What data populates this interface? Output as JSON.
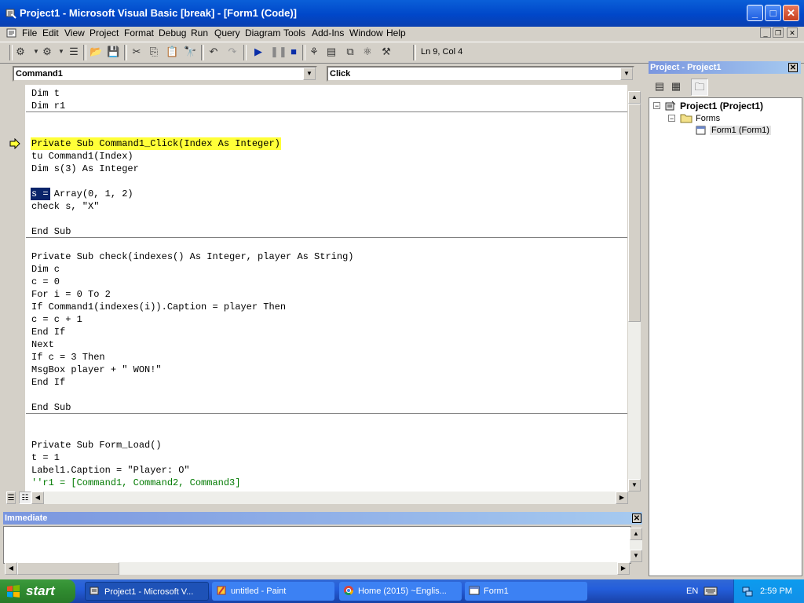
{
  "window": {
    "title": "Project1 - Microsoft Visual Basic [break] - [Form1 (Code)]"
  },
  "menu": [
    "File",
    "Edit",
    "View",
    "Project",
    "Format",
    "Debug",
    "Run",
    "Query",
    "Diagram",
    "Tools",
    "Add-Ins",
    "Window",
    "Help"
  ],
  "toolbar": {
    "cursor_position": "Ln 9, Col 4"
  },
  "code_window": {
    "object_combo": "Command1",
    "procedure_combo": "Click",
    "lines": [
      "Dim t",
      "Dim r1",
      "",
      "",
      "Private Sub Command1_Click(Index As Integer)",
      "tu Command1(Index)",
      "Dim s(3) As Integer",
      "",
      "s = Array(0, 1, 2)",
      "check s, \"X\"",
      "",
      "End Sub",
      "",
      "Private Sub check(indexes() As Integer, player As String)",
      "Dim c",
      "c = 0",
      "For i = 0 To 2",
      "If Command1(indexes(i)).Caption = player Then",
      "c = c + 1",
      "End If",
      "Next",
      "If c = 3 Then",
      "MsgBox player + \" WON!\"",
      "End If",
      "",
      "End Sub",
      "",
      "",
      "Private Sub Form_Load()",
      "t = 1",
      "Label1.Caption = \"Player: O\"",
      "''r1 = [Command1, Command2, Command3]"
    ]
  },
  "immediate": {
    "title": "Immediate"
  },
  "project_explorer": {
    "title": "Project - Project1",
    "root": "Project1 (Project1)",
    "folder": "Forms",
    "item": "Form1 (Form1)"
  },
  "taskbar": {
    "start_label": "start",
    "tasks": [
      "Project1 - Microsoft V...",
      "untitled - Paint",
      "Home (2015) ~Englis...",
      "Form1"
    ],
    "language": "EN",
    "clock": "2:59 PM"
  }
}
